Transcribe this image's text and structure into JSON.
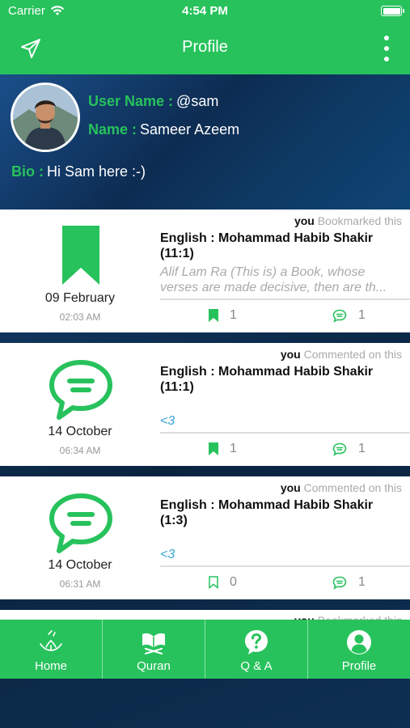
{
  "status_bar": {
    "carrier": "Carrier",
    "time": "4:54 PM"
  },
  "nav": {
    "title": "Profile",
    "left_icon": "send-icon",
    "right_icon": "more-vertical-icon"
  },
  "profile": {
    "username_label": "User Name :",
    "username": "@sam",
    "name_label": "Name :",
    "name": "Sameer Azeem",
    "bio_label": "Bio :",
    "bio": "Hi Sam here :-)"
  },
  "feed": [
    {
      "actor": "you",
      "action": "Bookmarked this",
      "type_icon": "bookmark-icon",
      "date": "09 February",
      "time": "02:03 AM",
      "verse": "English : Mohammad Habib Shakir (11:1)",
      "snippet": "Alif Lam Ra (This is) a Book, whose verses are made decisive, then are th...",
      "bookmarks": "1",
      "bookmarked": true,
      "comments": "1"
    },
    {
      "actor": "you",
      "action": "Commented on this",
      "type_icon": "comment-icon",
      "date": "14 October",
      "time": "06:34 AM",
      "verse": "English : Mohammad Habib Shakir (11:1)",
      "snippet": "<3",
      "bookmarks": "1",
      "bookmarked": true,
      "comments": "1"
    },
    {
      "actor": "you",
      "action": "Commented on this",
      "type_icon": "comment-icon",
      "date": "14 October",
      "time": "06:31 AM",
      "verse": "English : Mohammad Habib Shakir (1:3)",
      "snippet": "<3",
      "bookmarks": "0",
      "bookmarked": false,
      "comments": "1"
    },
    {
      "actor": "you",
      "action": "Bookmarked this"
    }
  ],
  "tabs": [
    {
      "label": "Home",
      "icon": "reading-hands-icon"
    },
    {
      "label": "Quran",
      "icon": "book-stand-icon"
    },
    {
      "label": "Q & A",
      "icon": "question-icon"
    },
    {
      "label": "Profile",
      "icon": "user-icon"
    }
  ],
  "colors": {
    "accent": "#27c25c",
    "link": "#3aa6d8"
  }
}
